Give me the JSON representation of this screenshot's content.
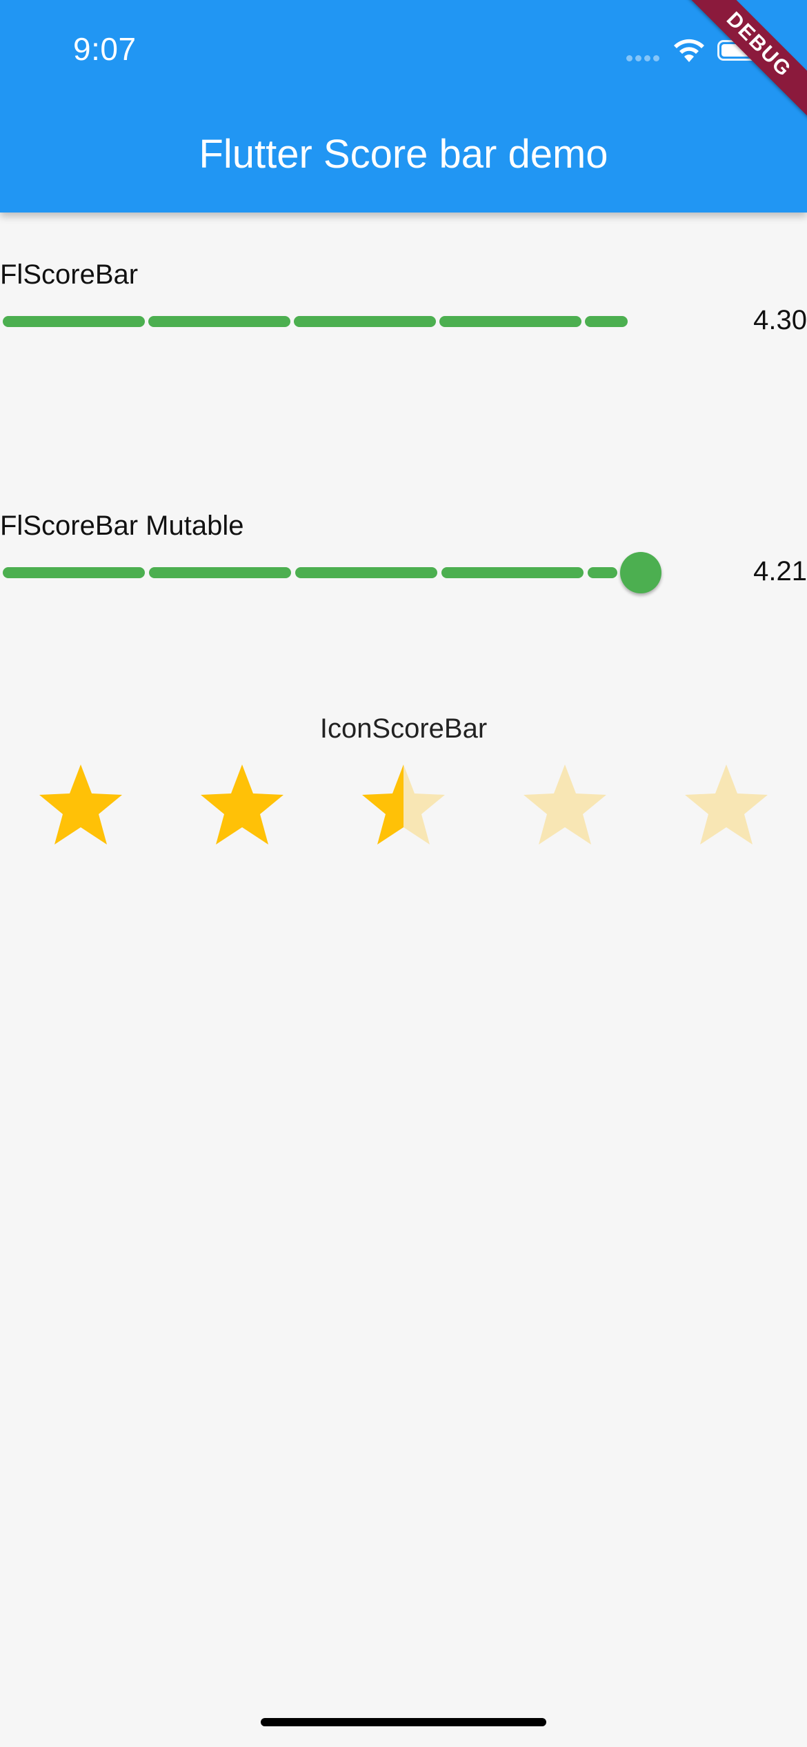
{
  "status_bar": {
    "time": "9:07",
    "icons": [
      "signal-icon",
      "wifi-icon",
      "battery-icon"
    ]
  },
  "app_bar": {
    "title": "Flutter Score bar demo",
    "color": "#2196f3"
  },
  "debug_banner": "DEBUG",
  "score_bar": {
    "label": "FlScoreBar",
    "value": "4.30",
    "score": 4.3,
    "max": 5,
    "color": "#4caf50"
  },
  "mutable_score_bar": {
    "label": "FlScoreBar Mutable",
    "value": "4.21",
    "score": 4.21,
    "max": 5,
    "color": "#4caf50"
  },
  "icon_score_bar": {
    "label": "IconScoreBar",
    "icon": "star-icon",
    "score": 2.5,
    "max": 5,
    "active_color": "#ffc107",
    "inactive_color": "#f8e6b4"
  }
}
